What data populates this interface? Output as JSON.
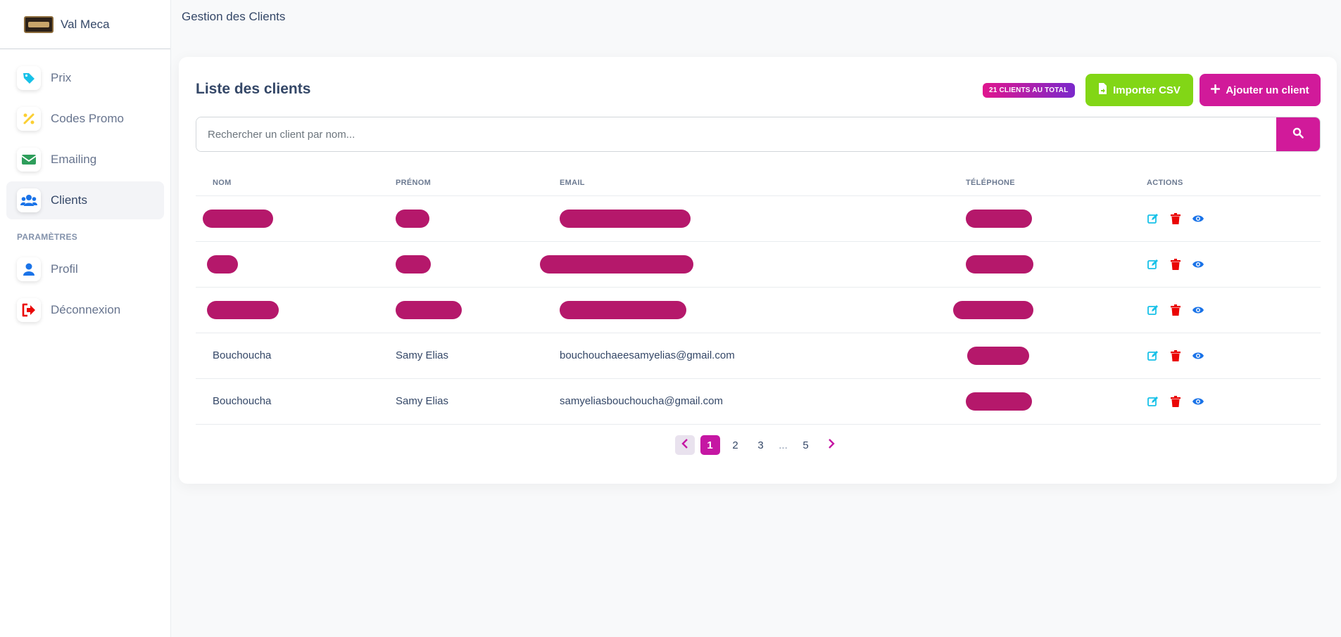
{
  "brand": {
    "name": "Val Meca"
  },
  "sidebar": {
    "items": [
      {
        "label": "Prix",
        "icon": "tag-icon"
      },
      {
        "label": "Codes Promo",
        "icon": "percent-icon"
      },
      {
        "label": "Emailing",
        "icon": "envelope-icon"
      },
      {
        "label": "Clients",
        "icon": "users-icon",
        "active": true
      }
    ],
    "section_label": "PARAMÈTRES",
    "settings_items": [
      {
        "label": "Profil",
        "icon": "user-icon"
      },
      {
        "label": "Déconnexion",
        "icon": "logout-icon"
      }
    ]
  },
  "header": {
    "title": "Gestion des Clients"
  },
  "card": {
    "title": "Liste des clients",
    "total_badge": "21 CLIENTS AU TOTAL",
    "import_label": "Importer CSV",
    "add_label": "Ajouter un client"
  },
  "search": {
    "placeholder": "Rechercher un client par nom..."
  },
  "table": {
    "headers": [
      "NOM",
      "PRÉNOM",
      "EMAIL",
      "TÉLÉPHONE",
      "ACTIONS"
    ],
    "rows": [
      {
        "nom": "",
        "prenom": "",
        "email": "",
        "telephone": ""
      },
      {
        "nom": "",
        "prenom": "",
        "email": "",
        "telephone": ""
      },
      {
        "nom": "",
        "prenom": "",
        "email": "",
        "telephone": ""
      },
      {
        "nom": "Bouchoucha",
        "prenom": "Samy Elias",
        "email": "bouchouchaeesamyelias@gmail.com",
        "telephone": ""
      },
      {
        "nom": "Bouchoucha",
        "prenom": "Samy Elias",
        "email": "samyeliasbouchoucha@gmail.com",
        "telephone": ""
      }
    ]
  },
  "pagination": {
    "pages": [
      "1",
      "2",
      "3",
      "5"
    ],
    "ellipsis": "...",
    "current": "1"
  },
  "colors": {
    "accent": "#d11a9a",
    "import": "#82d616",
    "edit": "#17c1e8",
    "delete": "#ea0606",
    "view": "#1a73e8",
    "redaction": "#b5186b"
  }
}
